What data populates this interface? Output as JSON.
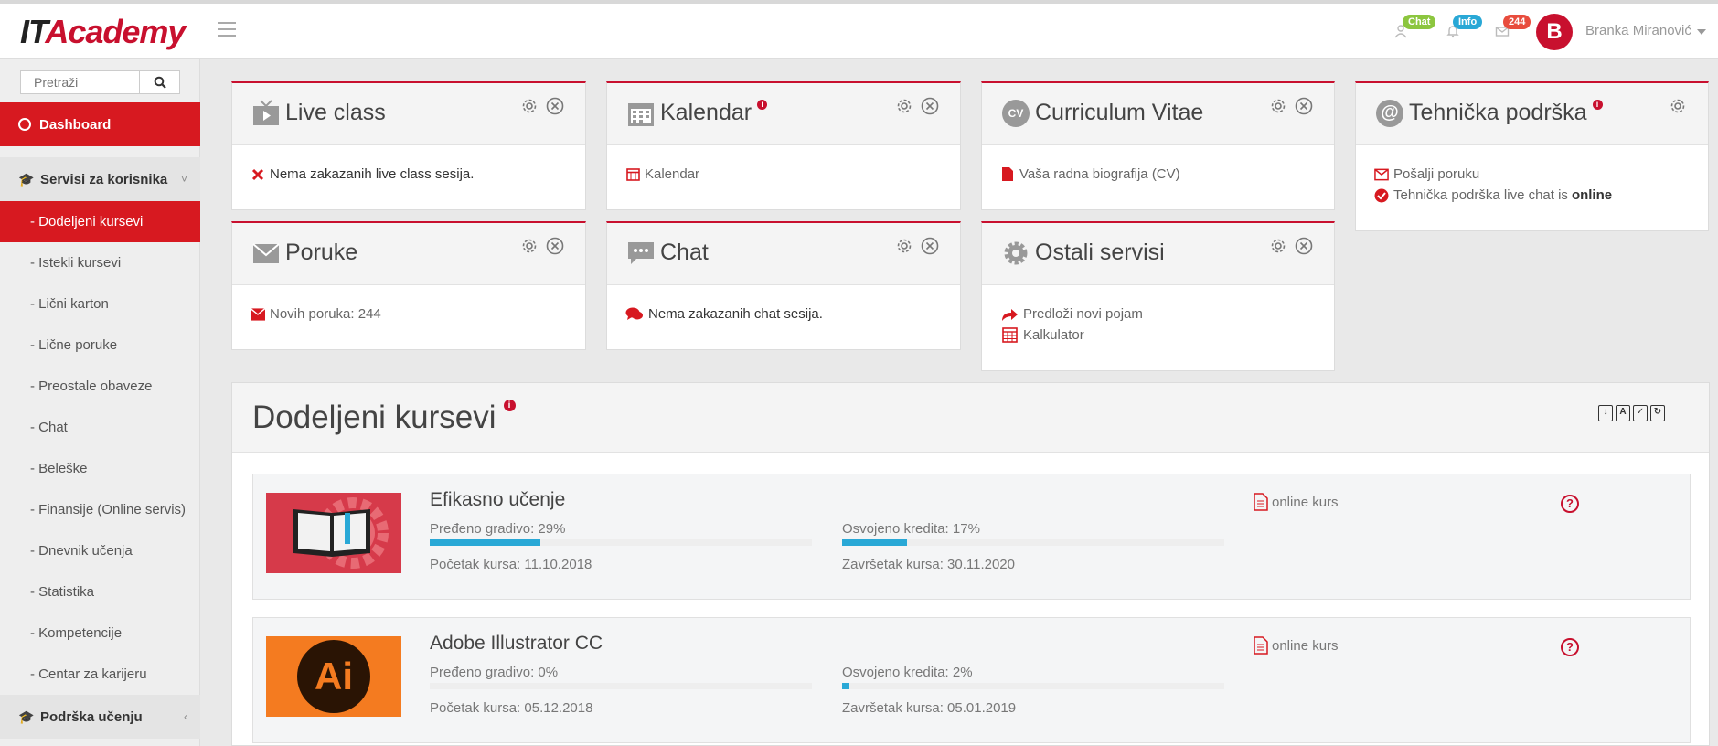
{
  "app": {
    "logo_it": "IT",
    "logo_rest": "Academy"
  },
  "header": {
    "badges": {
      "chat": "Chat",
      "info": "Info",
      "messages": "244"
    },
    "avatar_letter": "B",
    "user_name": "Branka Miranović"
  },
  "sidebar": {
    "search_placeholder": "Pretraži",
    "dashboard": "Dashboard",
    "section_services": "Servisi za korisnika",
    "items": [
      "- Dodeljeni kursevi",
      "- Istekli kursevi",
      "- Lični karton",
      "- Lične poruke",
      "- Preostale obaveze",
      "- Chat",
      "- Beleške",
      "- Finansije (Online servis)",
      "- Dnevnik učenja",
      "- Statistika",
      "- Kompetencije",
      "- Centar za karijeru"
    ],
    "section_support": "Podrška učenju"
  },
  "widgets": {
    "live": {
      "title": "Live class",
      "line1": "Nema zakazanih live class sesija."
    },
    "calendar": {
      "title": "Kalendar",
      "line1": "Kalendar"
    },
    "cv": {
      "title": "Curriculum Vitae",
      "icon_text": "CV",
      "line1": "Vaša radna biografija (CV)"
    },
    "support": {
      "title": "Tehnička podrška",
      "line1": "Pošalji poruku",
      "line2_prefix": "Tehnička podrška live chat is ",
      "line2_bold": "online"
    },
    "messages": {
      "title": "Poruke",
      "line1": "Novih poruka: 244"
    },
    "chat": {
      "title": "Chat",
      "line1": "Nema zakazanih chat sesija."
    },
    "other": {
      "title": "Ostali servisi",
      "line1": "Predloži novi pojam",
      "line2": "Kalkulator"
    }
  },
  "courses": {
    "title": "Dodeljeni kursevi",
    "list": [
      {
        "name": "Efikasno učenje",
        "progress_label": "Pređeno gradivo: 29%",
        "progress": 0.29,
        "credits_label": "Osvojeno kredita: 17%",
        "credits": 0.17,
        "start": "Početak kursa: 11.10.2018",
        "end": "Završetak kursa: 30.11.2020",
        "type": "online kurs"
      },
      {
        "name": "Adobe Illustrator CC",
        "progress_label": "Pređeno gradivo: 0%",
        "progress": 0.0,
        "credits_label": "Osvojeno kredita: 2%",
        "credits": 0.02,
        "start": "Početak kursa: 05.12.2018",
        "end": "Završetak kursa: 05.01.2019",
        "type": "online kurs",
        "thumb_text": "Ai"
      }
    ]
  },
  "colors": {
    "brand_red": "#d71920",
    "progress_blue": "#29a8d6",
    "chat_green": "#8cc63f",
    "info_blue": "#29a8d6",
    "msg_red": "#e84c3d"
  }
}
